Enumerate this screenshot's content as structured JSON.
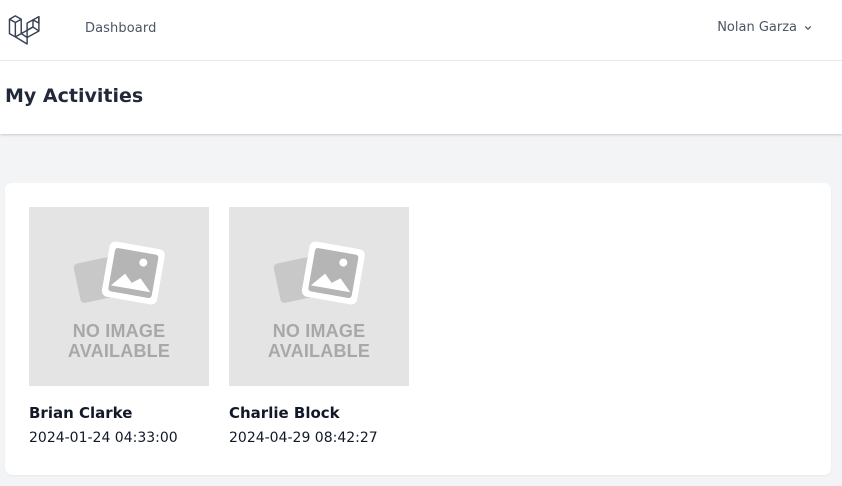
{
  "nav": {
    "logo_icon": "laravel-logo-icon",
    "dashboard_label": "Dashboard",
    "user_name": "Nolan Garza",
    "user_menu_icon": "chevron-down-icon"
  },
  "header": {
    "title": "My Activities"
  },
  "activities": [
    {
      "name": "Brian Clarke",
      "timestamp": "2024-01-24 04:33:00",
      "image_text_line1": "NO IMAGE",
      "image_text_line2": "AVAILABLE",
      "image_icon": "no-image-placeholder-icon"
    },
    {
      "name": "Charlie Block",
      "timestamp": "2024-04-29 08:42:27",
      "image_text_line1": "NO IMAGE",
      "image_text_line2": "AVAILABLE",
      "image_icon": "no-image-placeholder-icon"
    }
  ],
  "colors": {
    "background": "#f3f4f6",
    "surface": "#ffffff",
    "placeholder_bg": "#e4e4e4",
    "placeholder_fg": "#a8a8a8",
    "muted_text": "#4b5563"
  }
}
